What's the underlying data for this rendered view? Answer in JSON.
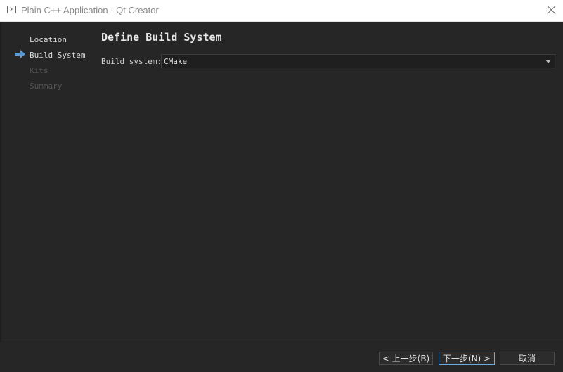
{
  "window": {
    "title": "Plain C++ Application - Qt Creator"
  },
  "steps": [
    {
      "label": "Location",
      "state": "done"
    },
    {
      "label": "Build System",
      "state": "current"
    },
    {
      "label": "Kits",
      "state": "disabled"
    },
    {
      "label": "Summary",
      "state": "disabled"
    }
  ],
  "page": {
    "title": "Define Build System",
    "build_system_label": "Build system:",
    "build_system_value": "CMake"
  },
  "buttons": {
    "back": "< 上一步(B)",
    "next": "下一步(N) >",
    "cancel": "取消"
  },
  "colors": {
    "background": "#262626",
    "accent": "#6fa8dc",
    "arrow": "#5b9bd5"
  },
  "icons": {
    "app": "terminal-icon",
    "close": "close-icon",
    "current_step": "arrow-right-icon",
    "dropdown": "chevron-down-icon"
  }
}
